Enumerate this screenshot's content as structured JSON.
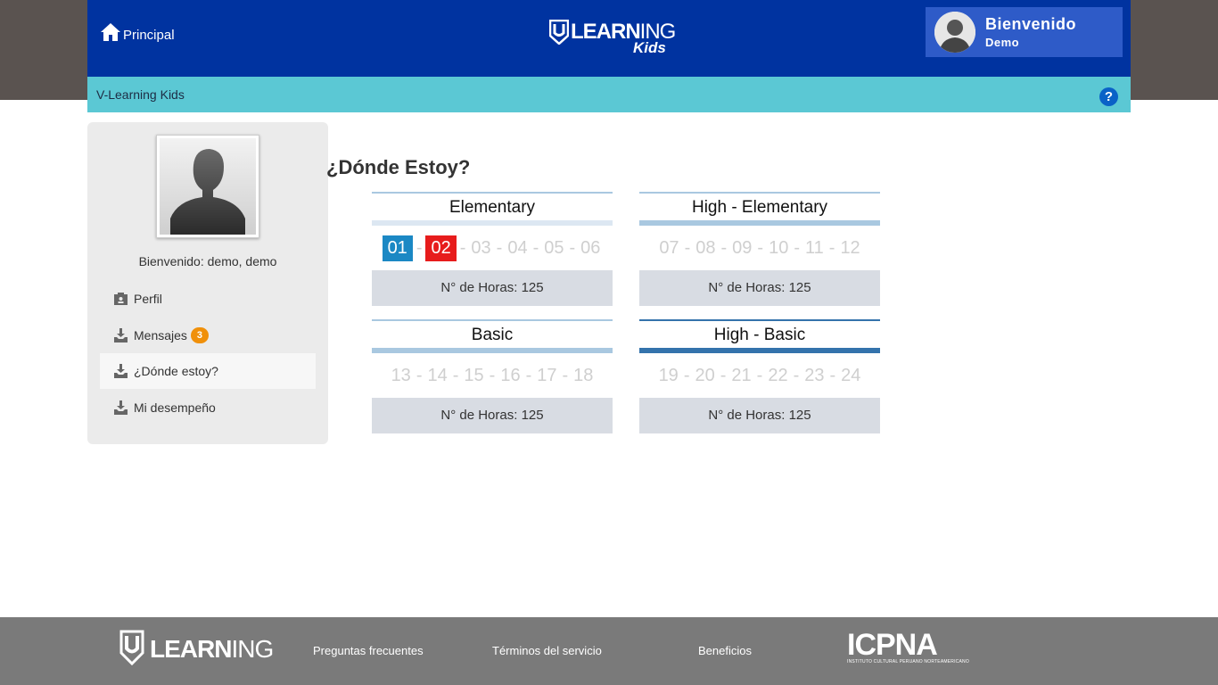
{
  "header": {
    "home_label": "Principal",
    "brand_word": "LEARN",
    "brand_word_thin": "ING",
    "brand_sub": "Kids",
    "welcome_title": "Bienvenido",
    "welcome_user": "Demo"
  },
  "subbar": {
    "title": "V-Learning Kids",
    "help_label": "?"
  },
  "sidebar": {
    "welcome": "Bienvenido: demo, demo",
    "items": [
      {
        "label": "Perfil",
        "icon": "id-card-icon",
        "badge": ""
      },
      {
        "label": "Mensajes",
        "icon": "inbox-download-icon",
        "badge": "3"
      },
      {
        "label": "¿Dónde estoy?",
        "icon": "inbox-download-icon",
        "badge": "",
        "active": true
      },
      {
        "label": "Mi desempeño",
        "icon": "inbox-download-icon",
        "badge": ""
      }
    ]
  },
  "main": {
    "title": "¿Dónde Estoy?",
    "levels": [
      {
        "name": "Elementary",
        "units": [
          "01",
          "02",
          "03",
          "04",
          "05",
          "06"
        ],
        "hours": "N° de Horas: 125"
      },
      {
        "name": "High - Elementary",
        "units": [
          "07",
          "08",
          "09",
          "10",
          "11",
          "12"
        ],
        "hours": "N° de Horas: 125"
      },
      {
        "name": "Basic",
        "units": [
          "13",
          "14",
          "15",
          "16",
          "17",
          "18"
        ],
        "hours": "N° de Horas: 125"
      },
      {
        "name": "High - Basic",
        "units": [
          "19",
          "20",
          "21",
          "22",
          "23",
          "24"
        ],
        "hours": "N° de Horas: 125"
      }
    ],
    "current_unit": "01",
    "goal_unit": "02"
  },
  "footer": {
    "logo_word": "LEARN",
    "logo_word_thin": "ING",
    "links": [
      "Preguntas frecuentes",
      "Términos del servicio",
      "Beneficios"
    ],
    "partner_name": "ICPNA",
    "partner_full": "INSTITUTO CULTURAL PERUANO NORTEAMERICANO"
  },
  "colors": {
    "header": "#0033a0",
    "subbar": "#5bc8d4",
    "current_unit": "#1b88c4",
    "goal_unit": "#e71c1c",
    "badge": "#f0900a"
  }
}
